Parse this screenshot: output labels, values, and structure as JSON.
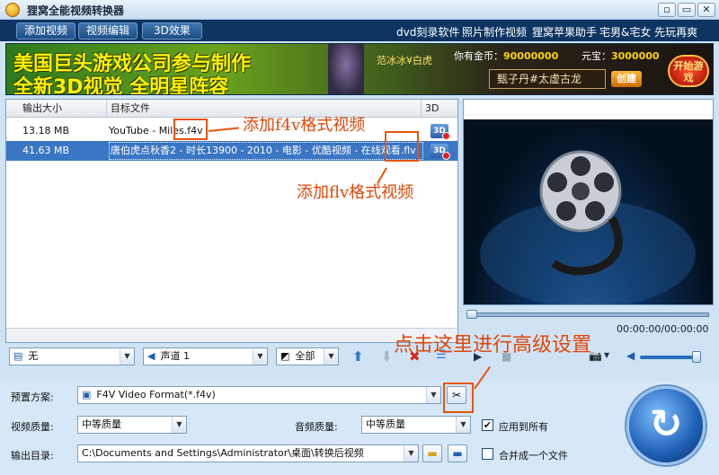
{
  "window": {
    "title": "狸窝全能视频转换器",
    "buttons": [
      "▫",
      "▭",
      "✕"
    ]
  },
  "toolbar": {
    "add_video": "添加视频",
    "edit_video": "视频编辑",
    "effect_3d": "3D效果",
    "links": [
      "dvd刻录软件",
      "照片制作视频",
      "狸窝苹果助手",
      "宅男&宅女 先玩再爽"
    ]
  },
  "banner": {
    "line1": "美国巨头游戏公司参与制作",
    "line2": "全新3D视觉 全明星阵容",
    "tag": "范冰冰¥白虎",
    "gold_label": "你有金币：",
    "gold_value": "90000000",
    "yuanbao_label": "元宝：",
    "yuanbao_value": "3000000",
    "name": "甄子丹#太虚古龙",
    "create": "创建",
    "start": "开始游戏"
  },
  "file_list": {
    "columns": [
      "输出大小",
      "目标文件",
      "3D"
    ],
    "rows": [
      {
        "size": "13.18 MB",
        "target": "YouTube - Miles.f4v",
        "selected": false
      },
      {
        "size": "41.63 MB",
        "target": "唐伯虎点秋香2 - 时长13900 - 2010 - 电影 - 优酷视频 - 在线观看.flv",
        "selected": true
      }
    ]
  },
  "player": {
    "time": "00:00:00/00:00:00"
  },
  "list_controls": {
    "subtitle": "无",
    "audio_track": "声道 1",
    "crop": "全部"
  },
  "settings": {
    "preset_label": "预置方案:",
    "preset_value": "F4V Video Format(*.f4v)",
    "video_quality_label": "视频质量:",
    "video_quality_value": "中等质量",
    "audio_quality_label": "音频质量:",
    "audio_quality_value": "中等质量",
    "apply_all_label": "应用到所有",
    "apply_all_checked": true,
    "output_label": "输出目录:",
    "output_value": "C:\\Documents and Settings\\Administrator\\桌面\\转换后视频",
    "merge_label": "合并成一个文件",
    "merge_checked": false
  },
  "annotations": {
    "f4v": "添加f4v格式视频",
    "flv": "添加flv格式视频",
    "advanced": "点击这里进行高级设置"
  },
  "colors": {
    "accent": "#e8550a",
    "selection": "#3a76c4",
    "toolbar_bg": "#0e3562"
  }
}
